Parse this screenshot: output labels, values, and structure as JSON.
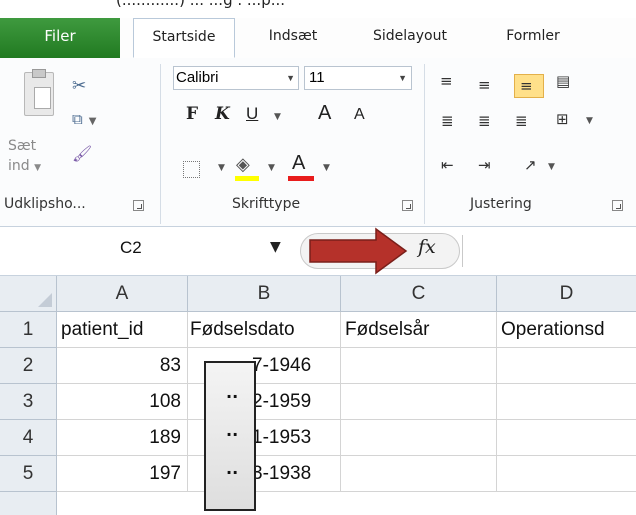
{
  "top_partial_text": "(............) ... ...g . ...p...",
  "tabs": [
    {
      "label": "Filer"
    },
    {
      "label": "Startside"
    },
    {
      "label": "Indsæt"
    },
    {
      "label": "Sidelayout"
    },
    {
      "label": "Formler"
    }
  ],
  "ribbon": {
    "clipboard": {
      "paste_label": "Sæt\nind",
      "group_label": "Udklipsho..."
    },
    "font": {
      "name": "Calibri",
      "size": "11",
      "bold": "F",
      "italic": "K",
      "underline": "U",
      "grow": "A",
      "shrink": "A",
      "group_label": "Skrifttype",
      "fill_color": "#ffff00",
      "font_color": "#e81c1c"
    },
    "alignment": {
      "group_label": "Justering"
    }
  },
  "formula_bar": {
    "name_box": "C2",
    "fx": "fx",
    "formula": ""
  },
  "sheet": {
    "columns": [
      "A",
      "B",
      "C",
      "D"
    ],
    "rows": [
      {
        "num": "1",
        "cells": [
          "patient_id",
          "Fødselsdato",
          "Fødselsår",
          "Operationsd"
        ]
      },
      {
        "num": "2",
        "cells": [
          "83",
          "-1946",
          "",
          ""
        ]
      },
      {
        "num": "3",
        "cells": [
          "108",
          "-1959",
          "",
          ""
        ]
      },
      {
        "num": "4",
        "cells": [
          "189",
          "-1953",
          "",
          ""
        ]
      },
      {
        "num": "5",
        "cells": [
          "197",
          "-1938",
          "",
          ""
        ]
      }
    ],
    "partial_digits": [
      "7",
      "2",
      "1",
      "3"
    ]
  },
  "mask_dots": [
    "..",
    "..",
    ".."
  ],
  "colors": {
    "accent_green": "#217a21",
    "arrow_red": "#b5312a",
    "highlight": "#ffe08a"
  }
}
